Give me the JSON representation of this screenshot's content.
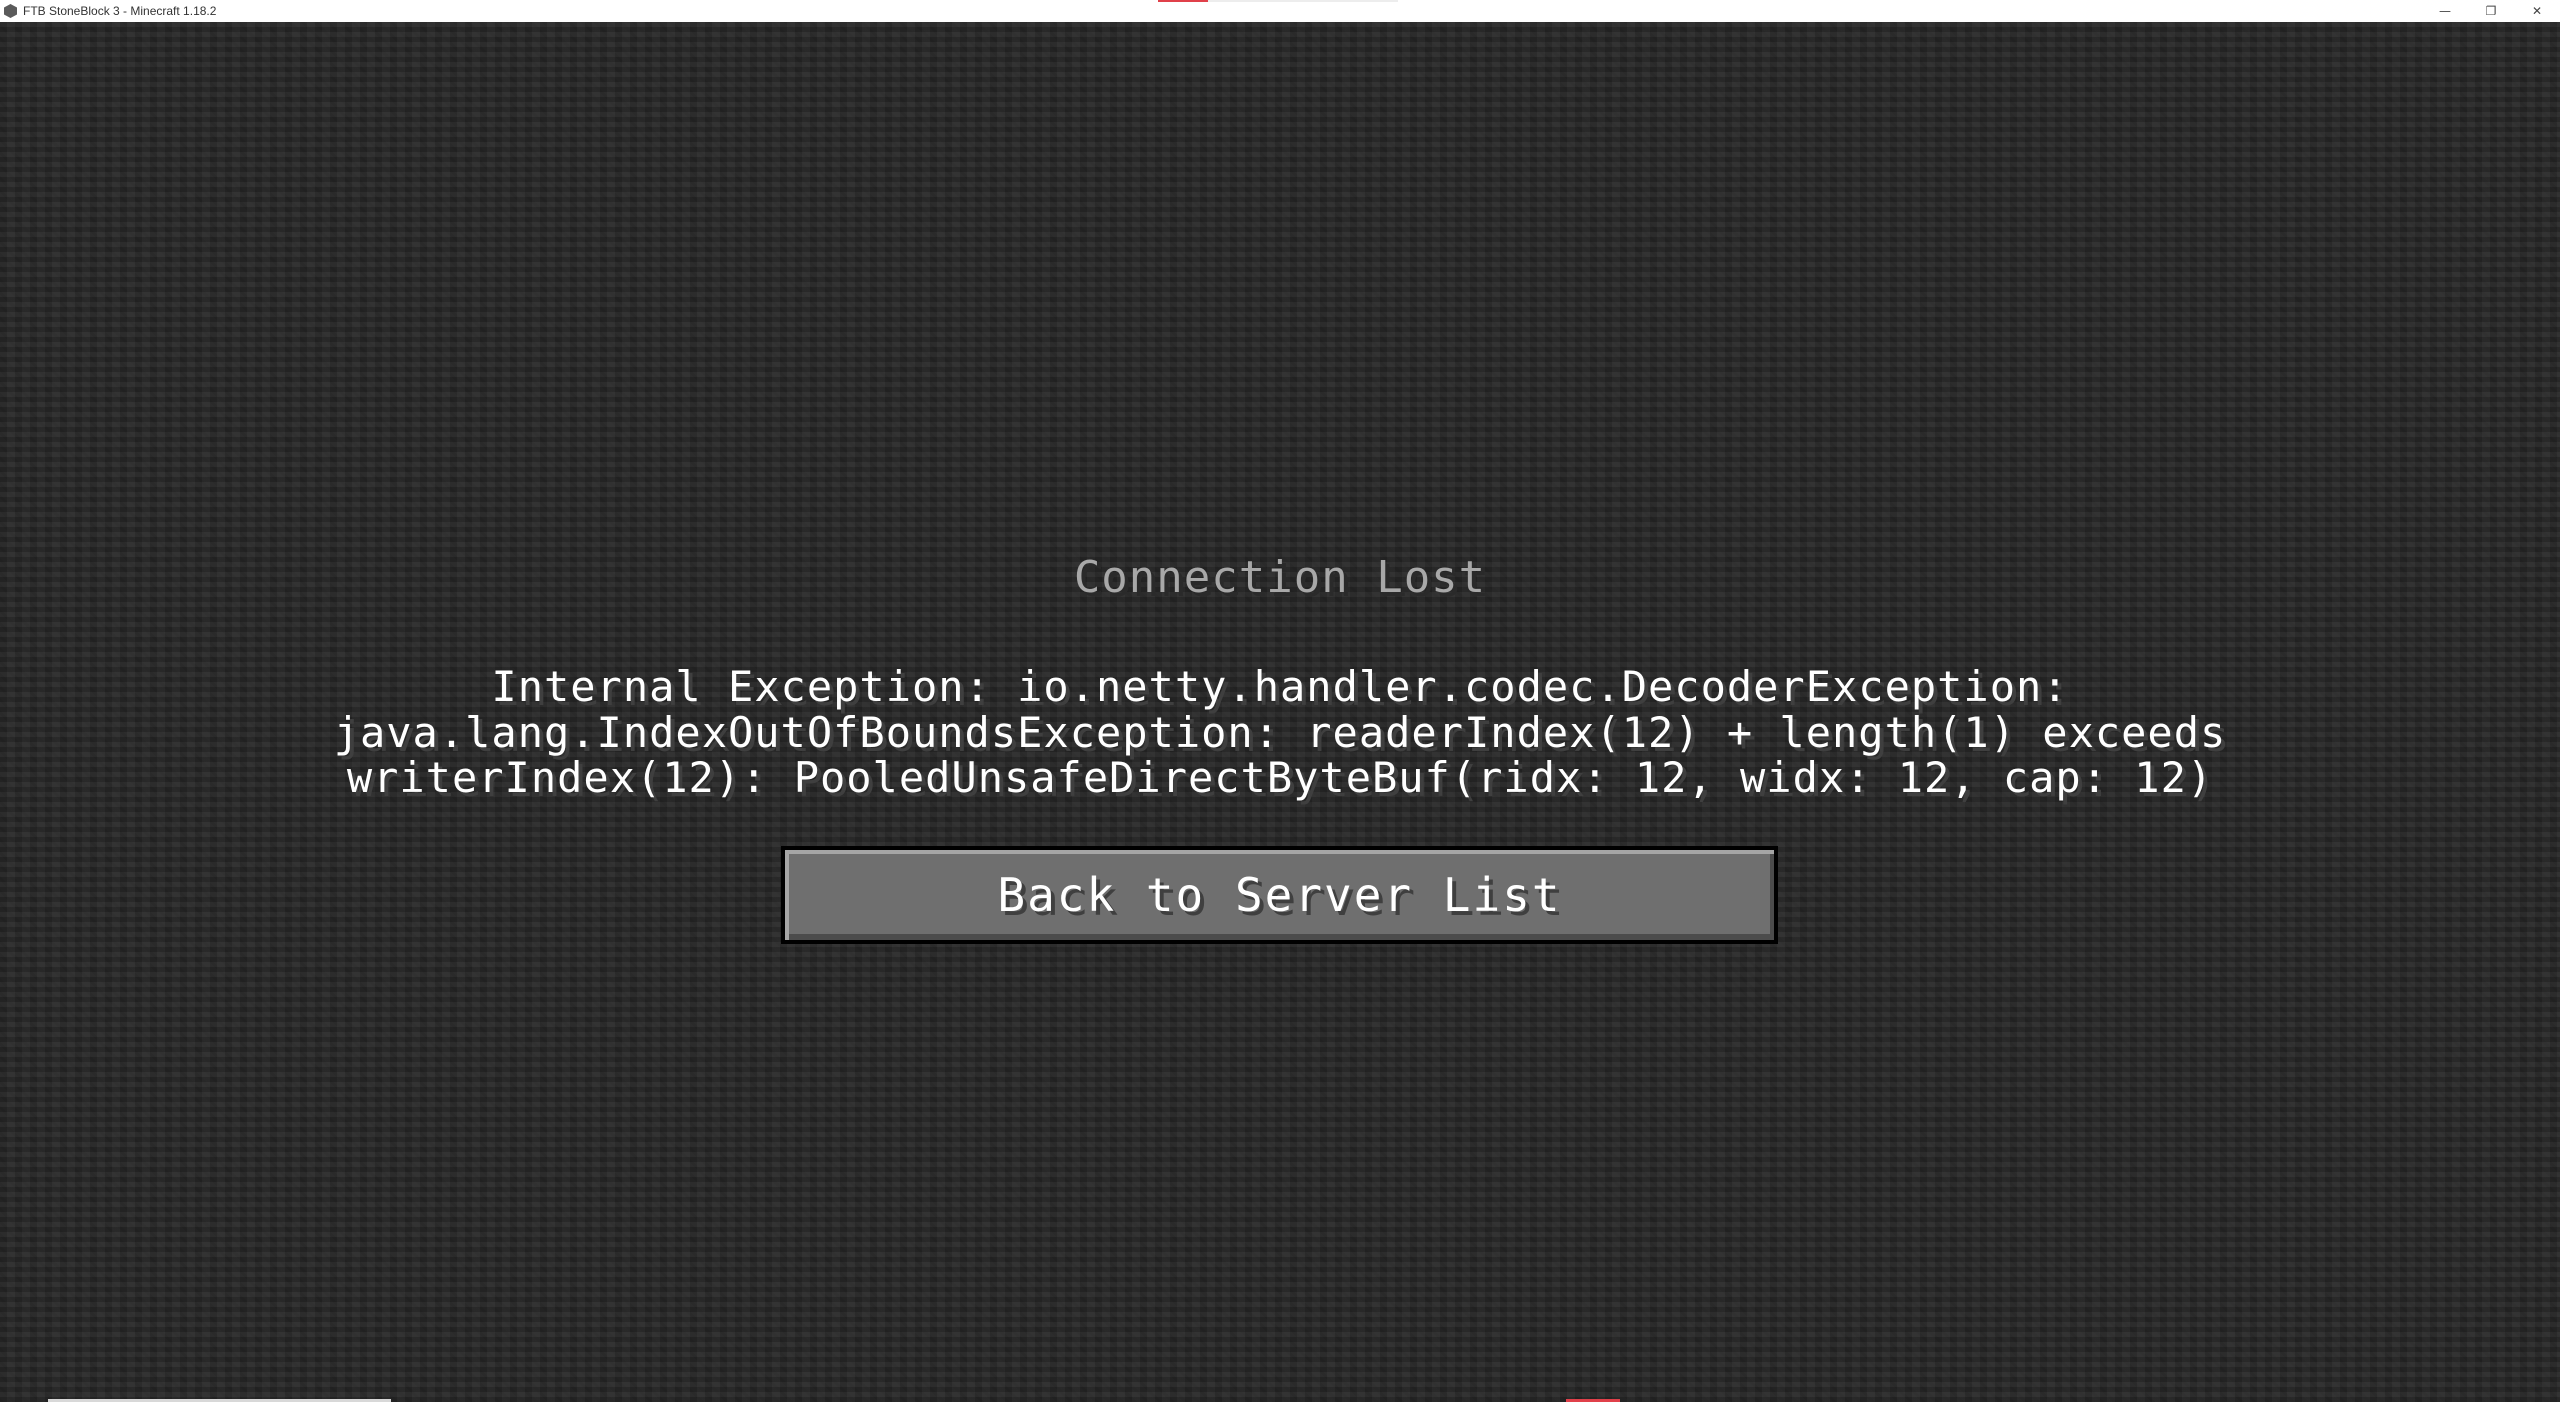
{
  "window": {
    "title": "FTB StoneBlock 3 - Minecraft 1.18.2",
    "accent_color": "#e0404a",
    "controls": {
      "minimize_icon": "minimize-icon",
      "restore_icon": "restore-icon",
      "close_icon": "close-icon",
      "minimize_glyph": "—",
      "restore_glyph": "❐",
      "close_glyph": "✕"
    }
  },
  "disconnect_screen": {
    "heading": "Connection Lost",
    "reason_lines": [
      "Internal Exception: io.netty.handler.codec.DecoderException:",
      "java.lang.IndexOutOfBoundsException: readerIndex(12) + length(1) exceeds",
      "writerIndex(12): PooledUnsafeDirectByteBuf(ridx: 12, widx: 12, cap: 12)"
    ],
    "back_button_label": "Back to Server List"
  },
  "colors": {
    "background": "#2a2a2a",
    "heading_text": "#a8a8a8",
    "body_text": "#ffffff",
    "button_face": "#6f6f6f"
  }
}
